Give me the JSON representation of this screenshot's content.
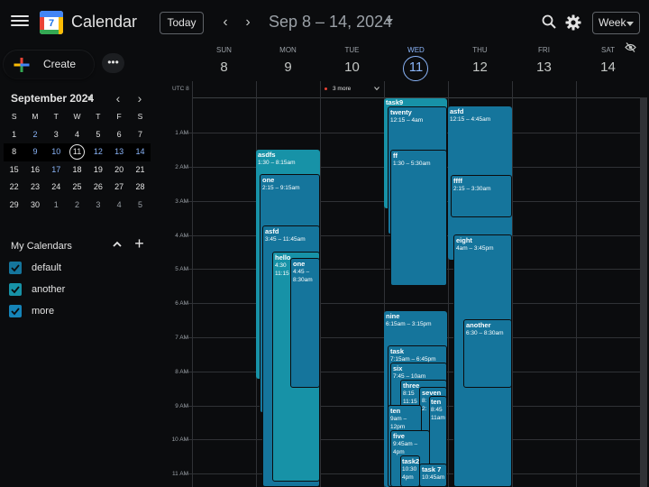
{
  "header": {
    "app_title": "Calendar",
    "logo_number": "7",
    "today_label": "Today",
    "prev_arrow": "‹",
    "next_arrow": "›",
    "date_range": "Sep 8 – 14, 2024",
    "view_label": "Week"
  },
  "sidebar": {
    "create_label": "Create",
    "more_label": "•••",
    "mini_month": "September 2024",
    "mini_prev": "‹",
    "mini_next": "›",
    "dow": [
      "S",
      "M",
      "T",
      "W",
      "T",
      "F",
      "S"
    ],
    "weeks": [
      [
        "1",
        "2",
        "3",
        "4",
        "5",
        "6",
        "7"
      ],
      [
        "8",
        "9",
        "10",
        "11",
        "12",
        "13",
        "14"
      ],
      [
        "15",
        "16",
        "17",
        "18",
        "19",
        "20",
        "21"
      ],
      [
        "22",
        "23",
        "24",
        "25",
        "26",
        "27",
        "28"
      ],
      [
        "29",
        "30",
        "1",
        "2",
        "3",
        "4",
        "5"
      ]
    ],
    "my_calendars_title": "My Calendars",
    "add_symbol": "+",
    "calendars": [
      {
        "name": "default",
        "color": "#15759c",
        "checked": true
      },
      {
        "name": "another",
        "color": "#1792a7",
        "checked": true
      },
      {
        "name": "more",
        "color": "#1584b8",
        "checked": true
      }
    ]
  },
  "week": {
    "days": [
      {
        "dow": "SUN",
        "num": "8"
      },
      {
        "dow": "MON",
        "num": "9"
      },
      {
        "dow": "TUE",
        "num": "10"
      },
      {
        "dow": "WED",
        "num": "11",
        "selected": true
      },
      {
        "dow": "THU",
        "num": "12"
      },
      {
        "dow": "FRI",
        "num": "13"
      },
      {
        "dow": "SAT",
        "num": "14"
      }
    ],
    "timezone": "UTC 8",
    "more_events": "3 more",
    "hour_labels": [
      "1 AM",
      "2 AM",
      "3 AM",
      "4 AM",
      "5 AM",
      "6 AM",
      "7 AM",
      "8 AM",
      "9 AM",
      "10 AM",
      "11 AM"
    ]
  },
  "events": [
    {
      "title": "task9",
      "time": "",
      "day": 3
    },
    {
      "title": "twenty",
      "time": "12:15 – 4am",
      "day": 3
    },
    {
      "title": "ff",
      "time": "1:30 – 5:30am",
      "day": 3
    },
    {
      "title": "asfd",
      "time": "12:15 – 4:45am",
      "day": 4
    },
    {
      "title": "ffff",
      "time": "2:15 – 3:30am",
      "day": 4
    },
    {
      "title": "eight",
      "time": "4am – 3:45pm",
      "day": 4
    },
    {
      "title": "another",
      "time": "6:30 – 8:30am",
      "day": 4
    },
    {
      "title": "asdfs",
      "time": "1:30 – 8:15am",
      "day": 1
    },
    {
      "title": "one",
      "time": "2:15 – 9:15am",
      "day": 1
    },
    {
      "title": "asfd",
      "time": "3:45 – 11:45am",
      "day": 1
    },
    {
      "title": "hello",
      "time": "4:30",
      "time2": "11:15",
      "day": 1
    },
    {
      "title": "one",
      "time": "4:45 –",
      "time2": "8:30am",
      "day": 1
    },
    {
      "title": "nine",
      "time": "6:15am – 3:15pm",
      "day": 3
    },
    {
      "title": "task",
      "time": "7:15am – 6:45pm",
      "day": 3
    },
    {
      "title": "six",
      "time": "7:45 – 10am",
      "day": 3
    },
    {
      "title": "three",
      "time": "8:15",
      "time2": "11:15",
      "day": 3
    },
    {
      "title": "seven",
      "time": "8:",
      "time2": "2:",
      "day": 3
    },
    {
      "title": "ten",
      "time": "8:45",
      "time2": "11am",
      "day": 3
    },
    {
      "title": "ten",
      "time": "9am –",
      "time2": "12pm",
      "day": 3
    },
    {
      "title": "five",
      "time": "9:45am –",
      "time2": "4pm",
      "day": 3
    },
    {
      "title": "task2",
      "time": "10:30",
      "time2": "4pm",
      "day": 3
    },
    {
      "title": "task 7",
      "time": "10:45am",
      "day": 3
    }
  ],
  "colors": {
    "background": "#0b0c0e",
    "event_dark": "#15759c",
    "event_teal": "#1792a7",
    "event_mid": "#1584b8",
    "accent": "#8ab4f8"
  }
}
